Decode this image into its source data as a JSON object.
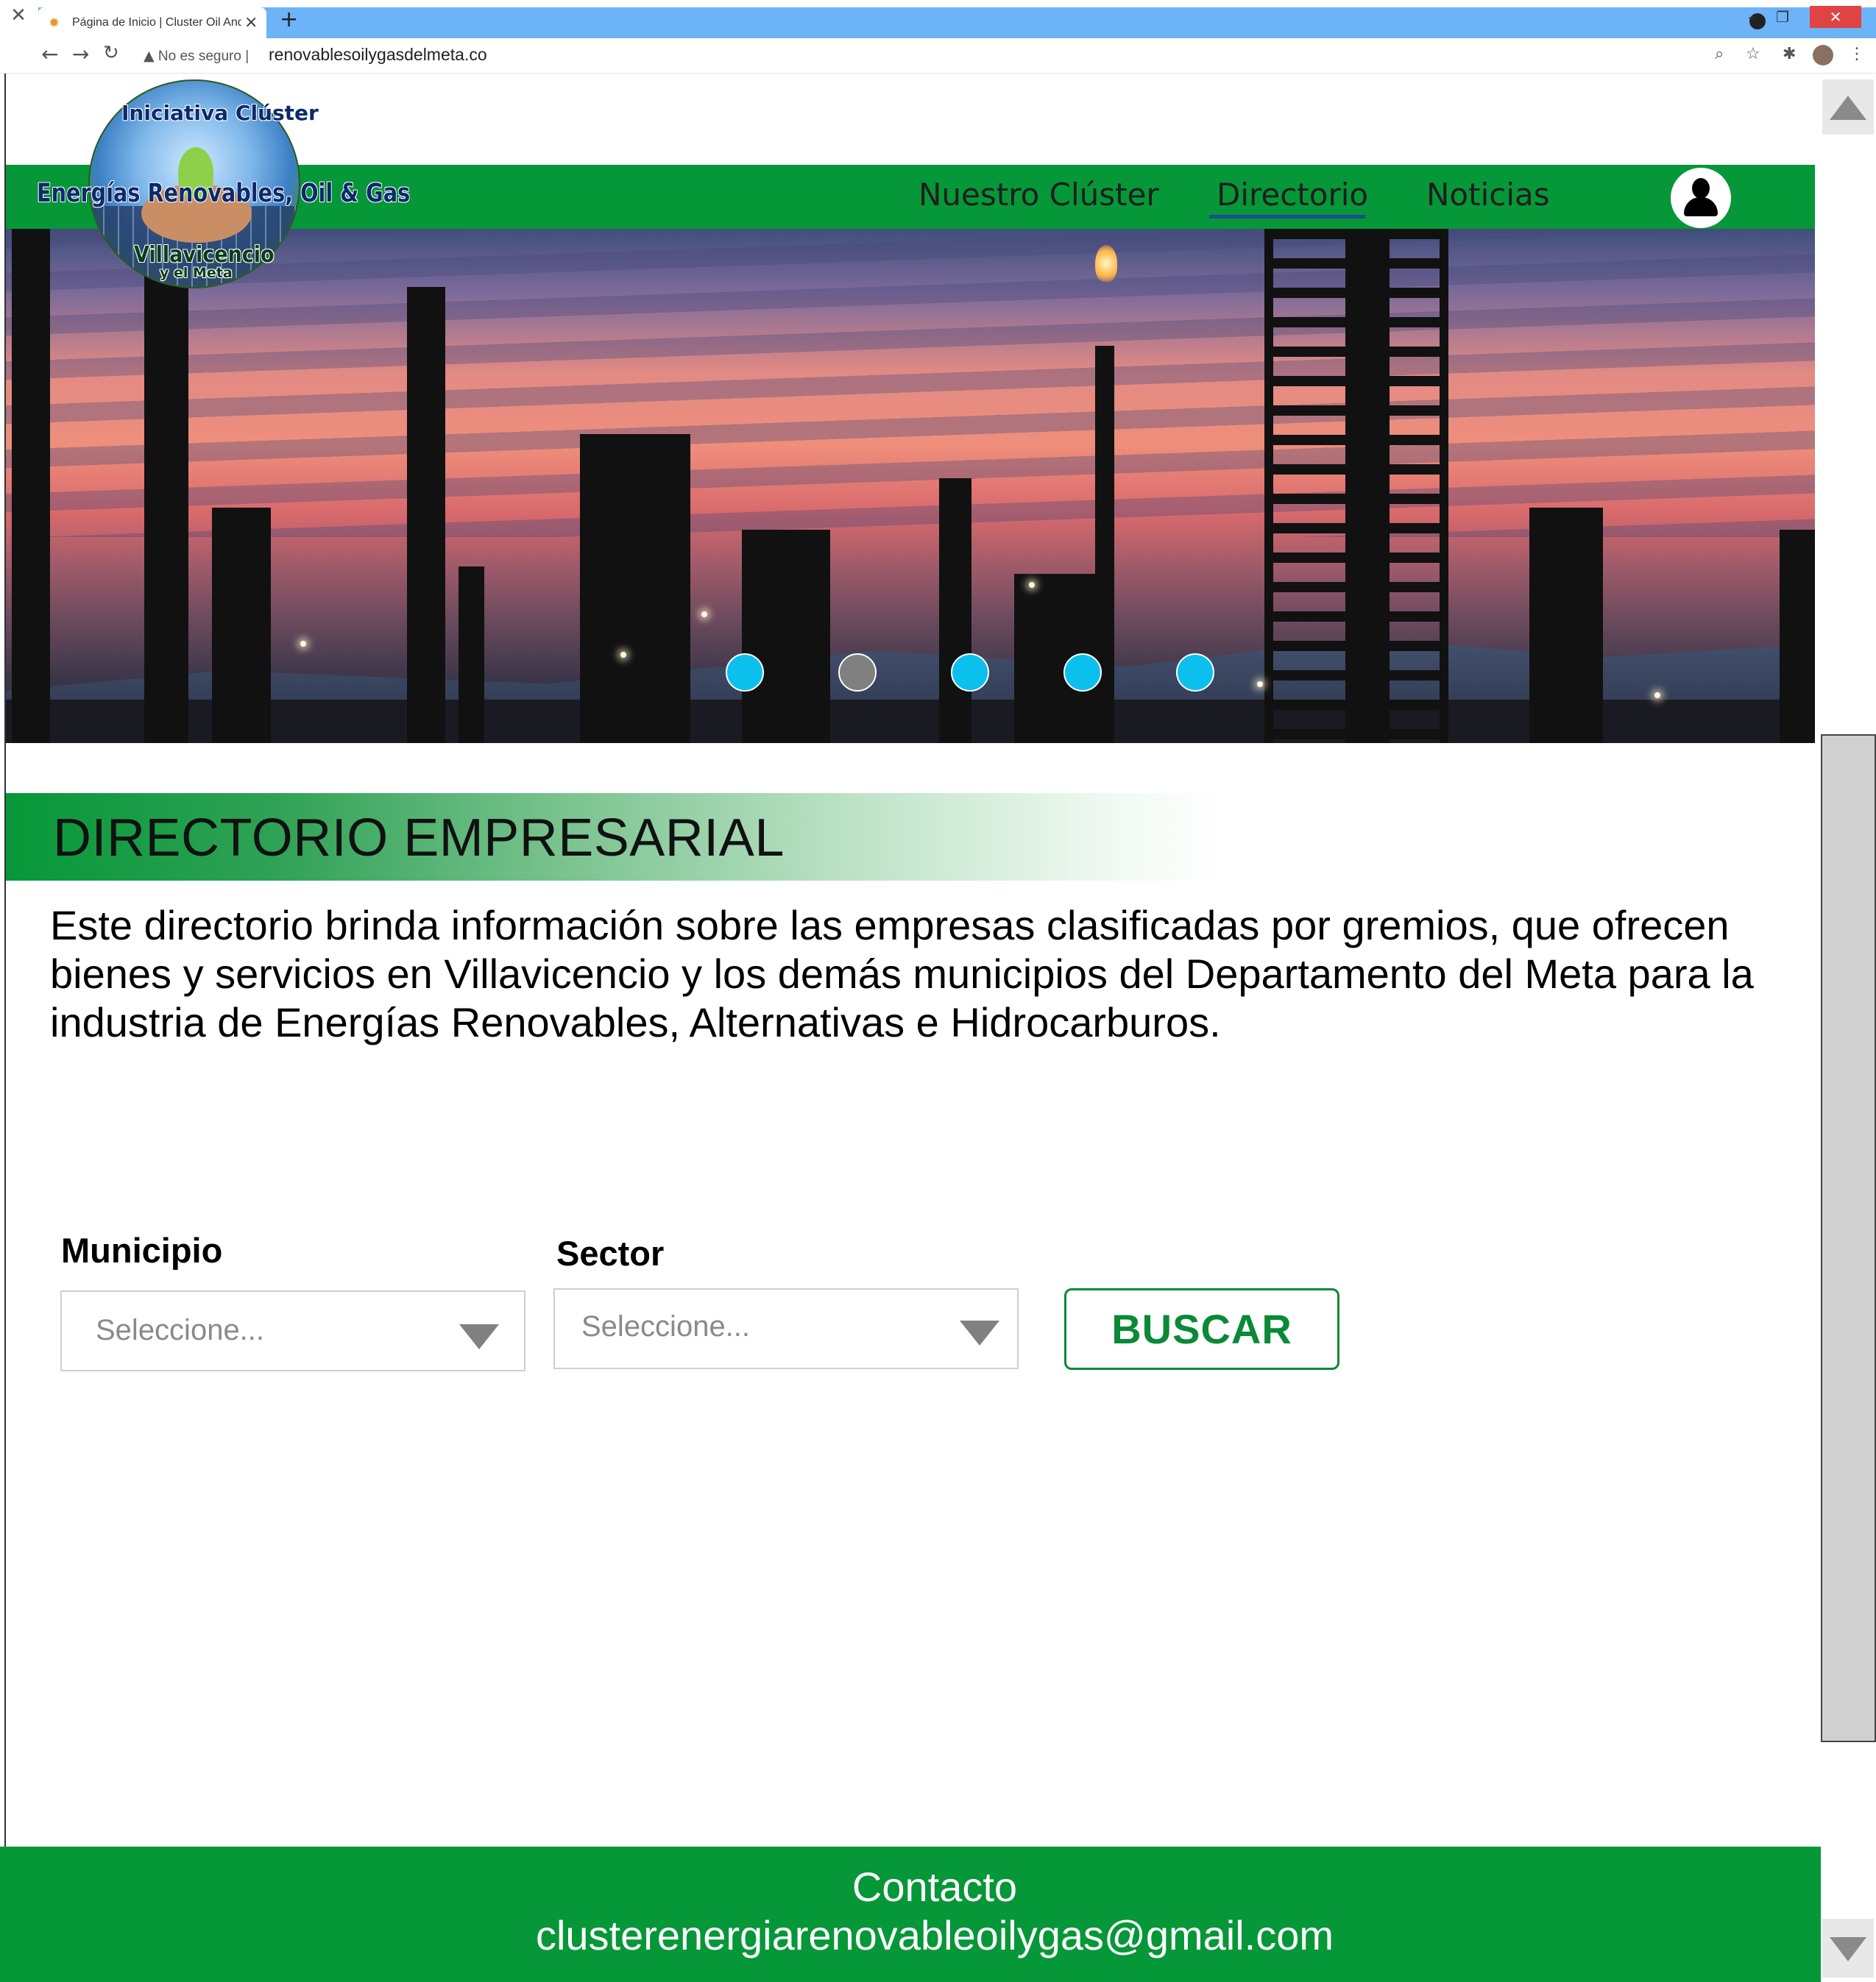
{
  "browser": {
    "tab_title": "Página de Inicio | Cluster Oil And",
    "security_label": "No es seguro",
    "url": "renovablesoilygasdelmeta.co"
  },
  "logo": {
    "line_top": "Iniciativa Clúster",
    "line_main": "Energías Renovables, Oil & Gas",
    "line_city": "Villavicencio",
    "line_region": "y el Meta"
  },
  "nav": {
    "items": [
      "Nuestro Clúster",
      "Directorio",
      "Noticias"
    ],
    "active": "Directorio"
  },
  "carousel": {
    "slide_count": 5,
    "active_index": 1
  },
  "directory": {
    "title": "DIRECTORIO EMPRESARIAL",
    "intro": "Este directorio brinda información sobre las empresas clasificadas por gremios, que ofrecen bienes y servicios en Villavicencio y los demás municipios del Departamento del Meta para la industria de Energías Renovables, Alternativas e Hidrocarburos."
  },
  "filters": {
    "municipio_label": "Municipio",
    "municipio_value": "Seleccione...",
    "sector_label": "Sector",
    "sector_value": "Seleccione...",
    "search_label": "BUSCAR"
  },
  "footer": {
    "title": "Contacto",
    "email": "clusterenergiarenovableoilygas@gmail.com"
  },
  "colors": {
    "brand_green": "#069738",
    "button_green": "#0a8a37",
    "dot_blue": "#0cc0ee",
    "dot_active": "#808080"
  },
  "icons": [
    "back-arrow-icon",
    "forward-arrow-icon",
    "reload-icon",
    "warning-icon",
    "zoom-icon",
    "star-icon",
    "extensions-icon",
    "menu-icon",
    "user-icon",
    "dropdown-arrow-icon"
  ]
}
